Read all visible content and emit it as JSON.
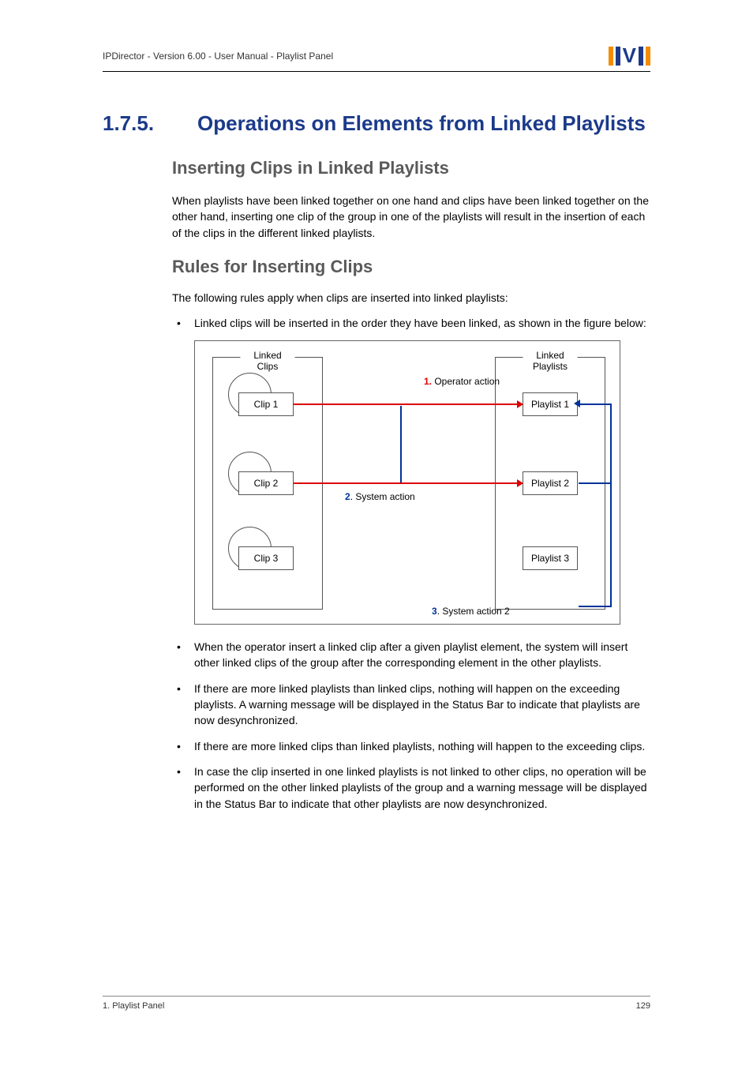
{
  "header": {
    "text": "IPDirector - Version 6.00 - User Manual - Playlist Panel"
  },
  "section": {
    "number": "1.7.5.",
    "title": "Operations on Elements from Linked Playlists"
  },
  "h2a": "Inserting Clips in Linked Playlists",
  "para1": "When playlists have been linked together on one hand and clips have been linked together on the other hand, inserting one clip of the group in one of the playlists will result in the insertion of each of the clips in the different linked playlists.",
  "h2b": "Rules for Inserting Clips",
  "rules_intro": "The following rules apply when clips are inserted into linked playlists:",
  "bullet1": "Linked clips will be inserted in the order they have been linked, as shown in the figure below:",
  "diagram": {
    "linked_clips_label": "Linked Clips",
    "linked_playlists_label": "Linked Playlists",
    "clip1": "Clip 1",
    "clip2": "Clip 2",
    "clip3": "Clip 3",
    "pl1": "Playlist 1",
    "pl2": "Playlist 2",
    "pl3": "Playlist 3",
    "cap1_num": "1.",
    "cap1_text": " Operator action",
    "cap2_num": "2",
    "cap2_text": ". System action",
    "cap3_num": "3",
    "cap3_text": ". System action 2"
  },
  "bullets_after": [
    "When the operator insert a linked clip after a given playlist element, the system will insert other linked clips of the group after the corresponding element in the other playlists.",
    "If there are more linked playlists than linked clips, nothing will happen on the exceeding playlists. A warning message will be displayed in the Status Bar to indicate that playlists are now desynchronized.",
    "If there are more linked clips than linked playlists, nothing will happen to the exceeding clips.",
    "In case the clip inserted in one linked playlists is not linked to other clips, no operation will be performed on the other linked playlists of the group and a warning message will be displayed in the Status Bar to indicate that other playlists are now desynchronized."
  ],
  "footer": {
    "left": "1. Playlist Panel",
    "right": "129"
  }
}
